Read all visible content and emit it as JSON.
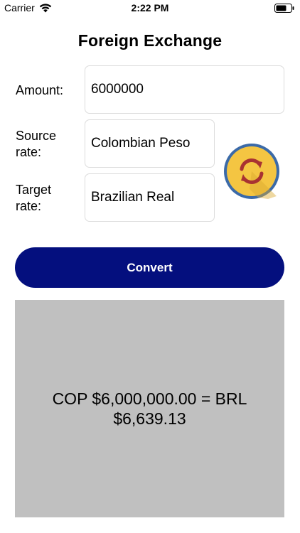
{
  "status_bar": {
    "carrier": "Carrier",
    "time": "2:22 PM",
    "wifi_icon": "wifi-icon",
    "battery_icon": "battery-icon"
  },
  "screen": {
    "title": "Foreign Exchange"
  },
  "form": {
    "amount_label": "Amount:",
    "amount_value": "6000000",
    "source_label": "Source rate:",
    "source_value": "Colombian Peso",
    "target_label": "Target rate:",
    "target_value": "Brazilian Real",
    "swap_icon": "swap-currencies-icon"
  },
  "actions": {
    "convert_label": "Convert"
  },
  "result": {
    "text": "COP $6,000,000.00 = BRL $6,639.13"
  },
  "colors": {
    "convert_button": "#040f7e",
    "result_panel": "#c0c0c0",
    "swap_circle": "#f4c542",
    "swap_ring": "#3b6aa8",
    "swap_arrows": "#a83232"
  }
}
